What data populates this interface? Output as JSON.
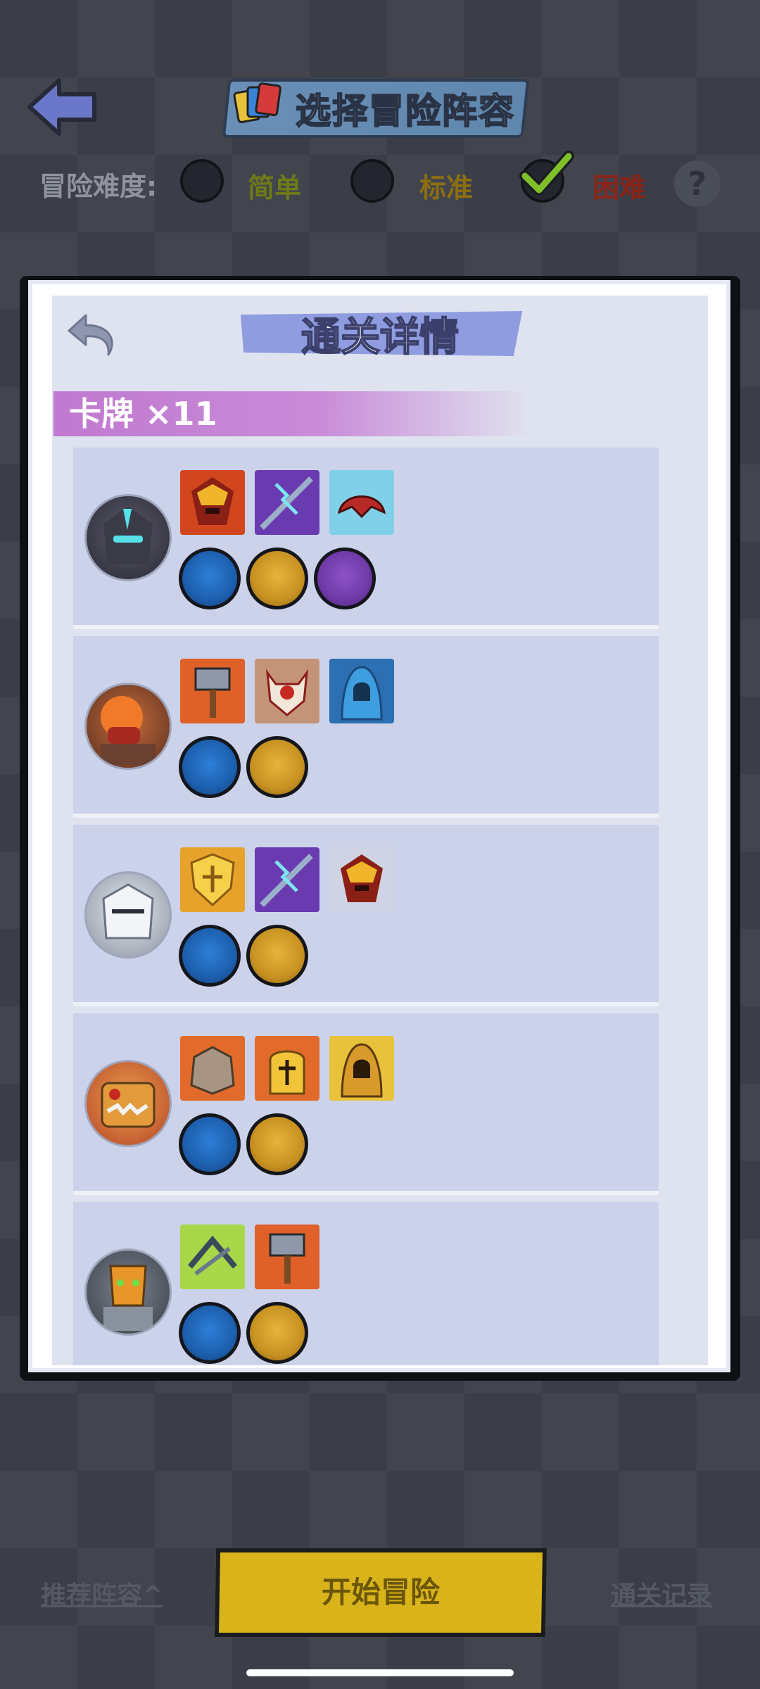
{
  "header": {
    "title": "选择冒险阵容",
    "back_icon": "back-arrow-icon",
    "cards_icon": "cards-stack-icon"
  },
  "difficulty": {
    "label": "冒险难度:",
    "options": [
      {
        "label": "简单",
        "selected": false,
        "color": "#6f7a18"
      },
      {
        "label": "标准",
        "selected": false,
        "color": "#8c6e12"
      },
      {
        "label": "困难",
        "selected": true,
        "color": "#8b2418"
      }
    ],
    "help_label": "?"
  },
  "panel": {
    "title": "通关详情",
    "card_count_label": "卡牌 ×11",
    "rows": [
      {
        "avatar": "dark-knight-hero",
        "cards": [
          "flame-mask-card",
          "lightning-spear-card",
          "crimson-claw-card"
        ],
        "gems": [
          "blue",
          "gold",
          "purple"
        ]
      },
      {
        "avatar": "orange-hair-hero",
        "cards": [
          "war-hammer-card",
          "demon-skull-card",
          "blue-hood-card"
        ],
        "gems": [
          "blue",
          "gold"
        ]
      },
      {
        "avatar": "white-armor-hero",
        "cards": [
          "golden-shield-card",
          "lightning-spear-card",
          "flame-mask-card"
        ],
        "gems": [
          "blue",
          "gold"
        ]
      },
      {
        "avatar": "robot-beast-hero",
        "cards": [
          "stone-golem-card",
          "golden-helmet-card",
          "gold-hood-card"
        ],
        "gems": [
          "blue",
          "gold"
        ]
      },
      {
        "avatar": "mask-golem-hero",
        "cards": [
          "crossbow-card",
          "war-hammer-card"
        ],
        "gems": [
          "blue",
          "gold"
        ]
      }
    ]
  },
  "bottom": {
    "recommend_label": "推荐阵容^",
    "start_label": "开始冒险",
    "record_label": "通关记录"
  }
}
